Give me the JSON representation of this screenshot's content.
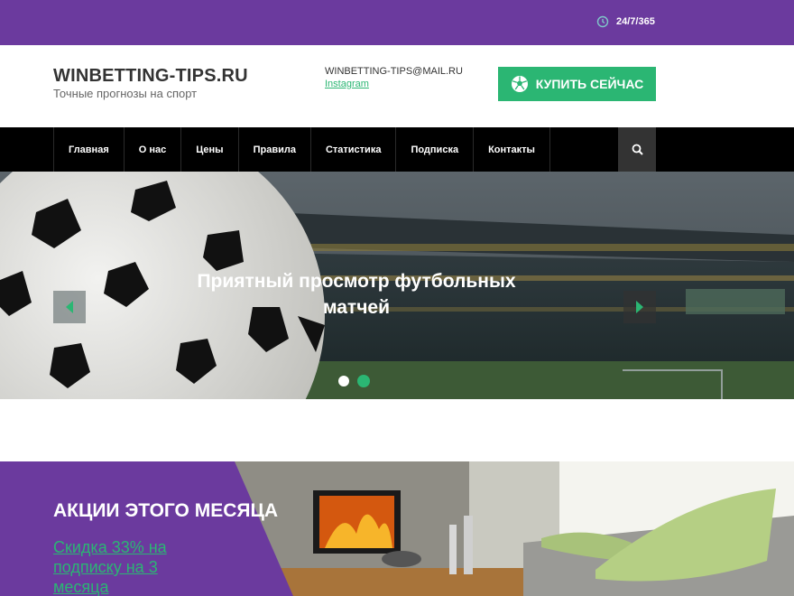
{
  "topbar": {
    "hours": "24/7/365",
    "icon": "clock-icon"
  },
  "header": {
    "site_title": "WINBETTING-TIPS.RU",
    "tagline": "Точные прогнозы на спорт",
    "email": "WINBETTING-TIPS@MAIL.RU",
    "instagram": "Instagram",
    "buy_label": "КУПИТЬ СЕЙЧАС",
    "buy_icon": "soccer-ball-icon"
  },
  "nav": {
    "items": [
      {
        "label": "Главная"
      },
      {
        "label": "О нас"
      },
      {
        "label": "Цены"
      },
      {
        "label": "Правила"
      },
      {
        "label": "Статистика"
      },
      {
        "label": "Подписка"
      },
      {
        "label": "Контакты"
      }
    ],
    "search_icon": "search-icon"
  },
  "hero": {
    "title": "Приятный просмотр футбольных матчей",
    "prev_icon": "chevron-left-icon",
    "next_icon": "chevron-right-icon",
    "slides": 2,
    "active_slide": 2
  },
  "promo": {
    "title": "АКЦИИ ЭТОГО МЕСЯЦА",
    "link": "Скидка 33% на подписку на 3 месяца"
  },
  "colors": {
    "purple": "#6b3a9e",
    "green": "#2bb673",
    "nav_bg": "#000000"
  }
}
